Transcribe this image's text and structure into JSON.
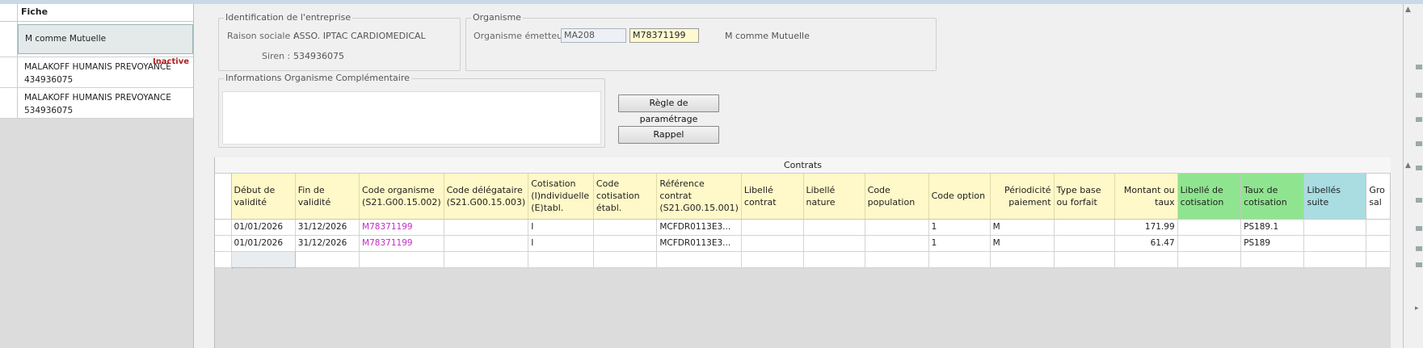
{
  "list": {
    "header": "Fiche",
    "items": [
      {
        "line1": "M comme Mutuelle",
        "line2": "",
        "selected": true,
        "badge": ""
      },
      {
        "line1": "MALAKOFF HUMANIS PREVOYANCE",
        "line2": "434936075",
        "selected": false,
        "badge": "Inactive"
      },
      {
        "line1": "MALAKOFF HUMANIS PREVOYANCE",
        "line2": "534936075",
        "selected": false,
        "badge": ""
      }
    ]
  },
  "entreprise": {
    "legend": "Identification de l'entreprise",
    "raison_label": "Raison sociale :",
    "raison_value": "ASSO. IPTAC CARDIOMEDICAL",
    "siren_label": "Siren :",
    "siren_value": "534936075"
  },
  "organisme": {
    "legend": "Organisme",
    "emetteur_label": "Organisme émetteur :",
    "code_value": "MA208",
    "id_value": "M78371199",
    "name": "M comme Mutuelle"
  },
  "info": {
    "legend": "Informations Organisme Complémentaire",
    "text": ""
  },
  "buttons": {
    "regle": "Règle de paramétrage",
    "rappel": "Rappel"
  },
  "contrats": {
    "title": "Contrats",
    "columns": [
      {
        "label": "Début de validité",
        "color": "yellow"
      },
      {
        "label": "Fin de validité",
        "color": "yellow"
      },
      {
        "label": "Code organisme (S21.G00.15.002)",
        "color": "yellow"
      },
      {
        "label": "Code délégataire (S21.G00.15.003)",
        "color": "yellow"
      },
      {
        "label": "Cotisation (I)ndividuelle (E)tabl.",
        "color": "yellow"
      },
      {
        "label": "Code cotisation établ.",
        "color": "yellow"
      },
      {
        "label": "Référence contrat (S21.G00.15.001)",
        "color": "yellow"
      },
      {
        "label": "Libellé contrat",
        "color": "yellow"
      },
      {
        "label": "Libellé nature",
        "color": "yellow"
      },
      {
        "label": "Code population",
        "color": "yellow"
      },
      {
        "label": "Code option",
        "color": "yellow"
      },
      {
        "label": "Périodicité paiement",
        "color": "yellow-right"
      },
      {
        "label": "Type base ou forfait",
        "color": "yellow"
      },
      {
        "label": "Montant ou taux",
        "color": "yellow-right"
      },
      {
        "label": "Libellé de cotisation",
        "color": "green"
      },
      {
        "label": "Taux de cotisation",
        "color": "green"
      },
      {
        "label": "Libellés suite",
        "color": "cyan"
      },
      {
        "label": "Gro sal",
        "color": "white"
      }
    ],
    "rows": [
      [
        "01/01/2026",
        "31/12/2026",
        "M78371199",
        "",
        "I",
        "",
        "MCFDR0113E3...",
        "",
        "",
        "",
        "1",
        "M",
        "",
        "171.99",
        "",
        "PS189.1",
        "",
        ""
      ],
      [
        "01/01/2026",
        "31/12/2026",
        "M78371199",
        "",
        "I",
        "",
        "MCFDR0113E3...",
        "",
        "",
        "",
        "1",
        "M",
        "",
        "61.47",
        "",
        "PS189",
        "",
        ""
      ]
    ]
  }
}
